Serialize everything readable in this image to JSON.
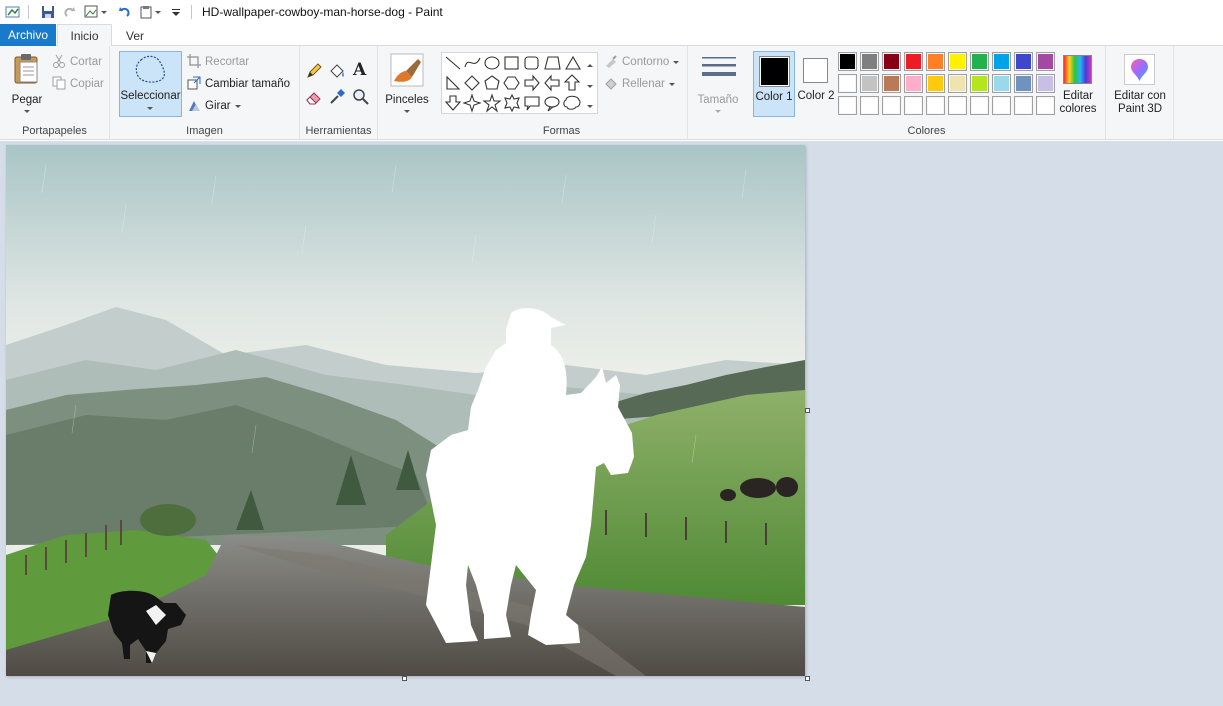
{
  "window": {
    "title": "HD-wallpaper-cowboy-man-horse-dog - Paint"
  },
  "tabs": {
    "archivo": "Archivo",
    "inicio": "Inicio",
    "ver": "Ver"
  },
  "portapapeles": {
    "paste": "Pegar",
    "cut": "Cortar",
    "copy": "Copiar",
    "label": "Portapapeles"
  },
  "imagen": {
    "select": "Seleccionar",
    "crop": "Recortar",
    "resize": "Cambiar tamaño",
    "rotate": "Girar",
    "label": "Imagen"
  },
  "herramientas": {
    "label": "Herramientas",
    "brushes": "Pinceles"
  },
  "formas": {
    "outline": "Contorno",
    "fill": "Rellenar",
    "label": "Formas"
  },
  "tamano": {
    "label": "Tamaño"
  },
  "colores": {
    "color1": "Color 1",
    "color1_value": "#000000",
    "color2": "Color 2",
    "color2_value": "#ffffff",
    "edit": "Editar colores",
    "label": "Colores",
    "palette": [
      [
        "#000000",
        "#7f7f7f",
        "#880015",
        "#ed1c24",
        "#ff7f27",
        "#fff200",
        "#22b14c",
        "#00a2e8",
        "#3f48cc",
        "#a349a4"
      ],
      [
        "#ffffff",
        "#c3c3c3",
        "#b97a57",
        "#ffaec9",
        "#ffc90e",
        "#efe4b0",
        "#b5e61d",
        "#99d9ea",
        "#7092be",
        "#c8bfe7"
      ],
      [
        "#ffffff",
        "#ffffff",
        "#ffffff",
        "#ffffff",
        "#ffffff",
        "#ffffff",
        "#ffffff",
        "#ffffff",
        "#ffffff",
        "#ffffff"
      ]
    ]
  },
  "paint3d": {
    "label": "Editar con Paint 3D"
  }
}
